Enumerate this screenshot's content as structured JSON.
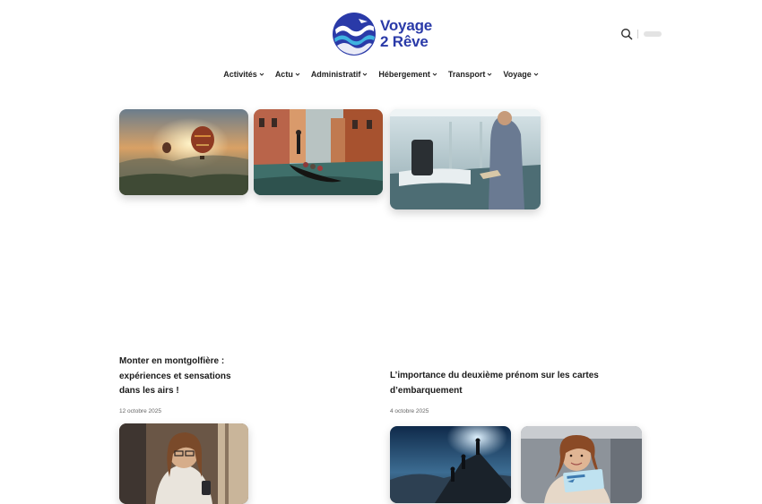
{
  "brand": {
    "name_line1": "Voyage",
    "name_line2": "2 Rêve",
    "colors": {
      "primary": "#2a3aa8",
      "accent": "#3fb3e0"
    }
  },
  "header": {
    "search_icon": "search-icon",
    "toggle": "dark-mode-toggle"
  },
  "nav": {
    "items": [
      {
        "label": "Activités"
      },
      {
        "label": "Actu"
      },
      {
        "label": "Administratif"
      },
      {
        "label": "Hébergement"
      },
      {
        "label": "Transport"
      },
      {
        "label": "Voyage"
      }
    ]
  },
  "top_images": [
    {
      "name": "hot-air-balloons-image"
    },
    {
      "name": "venice-gondola-image"
    },
    {
      "name": "airport-check-in-image"
    }
  ],
  "posts": [
    {
      "title": "Monter en montgolfière : expériences et sensations dans les airs !",
      "date": "12 octobre 2025"
    },
    {
      "title": "L’importance du deuxième prénom sur les cartes d’embarquement",
      "date": "4 octobre 2025"
    }
  ],
  "bottom_images": [
    {
      "name": "woman-phone-cafe-image"
    },
    {
      "name": "hikers-mountain-night-image"
    },
    {
      "name": "woman-boarding-pass-image"
    }
  ]
}
